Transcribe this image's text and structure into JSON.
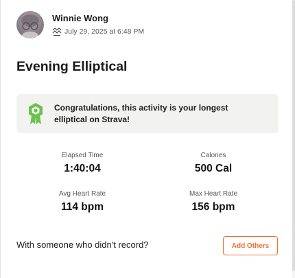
{
  "athlete": {
    "name": "Winnie Wong",
    "date": "July 29, 2025 at 6:48 PM",
    "avatar_icon": "avatar-photo"
  },
  "activity": {
    "title": "Evening Elliptical",
    "sport_icon": "elliptical-icon"
  },
  "achievement": {
    "icon": "badge-icon",
    "icon_color": "#6cc24a",
    "message": "Congratulations, this activity is your longest elliptical on Strava!"
  },
  "stats": [
    {
      "label": "Elapsed Time",
      "value": "1:40:04"
    },
    {
      "label": "Calories",
      "value": "500 Cal"
    },
    {
      "label": "Avg Heart Rate",
      "value": "114 bpm"
    },
    {
      "label": "Max Heart Rate",
      "value": "156 bpm"
    }
  ],
  "footer": {
    "prompt": "With someone who didn't record?",
    "button_label": "Add Others",
    "accent_color": "#f26d2e"
  }
}
